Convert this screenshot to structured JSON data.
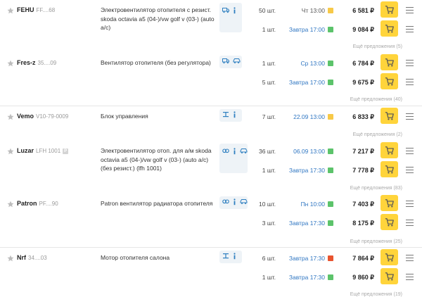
{
  "groups": [
    {
      "brand": "FEHU",
      "article": "FF....68",
      "badge": "",
      "desc": "Электровентилятор отопителя с резист. skoda octavia a5 (04-)/vw golf v (03-) (auto a/c)",
      "icons": [
        "truck-icon",
        "info-icon"
      ],
      "offers": [
        {
          "qty": "50 шт.",
          "date": "Чт 13:00",
          "stock_color": "#f7c948",
          "price": "6 581 ₽",
          "date_style": "grey"
        },
        {
          "qty": "1 шт.",
          "date": "Завтра 17:00",
          "stock_color": "#5cc36b",
          "price": "9 084 ₽",
          "date_style": "blue"
        }
      ],
      "more": "Ещё предложения (5)"
    },
    {
      "brand": "Fres-z",
      "article": "35....09",
      "badge": "",
      "desc": "Вентилятор отопителя (без регулятора)",
      "icons": [
        "truck-icon",
        "car-icon"
      ],
      "offers": [
        {
          "qty": "1 шт.",
          "date": "Ср 13:00",
          "stock_color": "#5cc36b",
          "price": "6 784 ₽",
          "date_style": "blue"
        },
        {
          "qty": "5 шт.",
          "date": "Завтра 17:00",
          "stock_color": "#5cc36b",
          "price": "9 675 ₽",
          "date_style": "blue"
        }
      ],
      "more": "Ещё предложения (40)"
    },
    {
      "brand": "Vemo",
      "article": "V10-79-0009",
      "badge": "",
      "desc": "Блок управления",
      "icons": [
        "scale-icon",
        "info-icon"
      ],
      "offers": [
        {
          "qty": "7 шт.",
          "date": "22.09 13:00",
          "stock_color": "#f7c948",
          "price": "6 833 ₽",
          "date_style": "blue"
        }
      ],
      "more": "Ещё предложения (2)"
    },
    {
      "brand": "Luzar",
      "article": "LFH 1001",
      "badge": "",
      "desc": "Электровентилятор отоп. для а/м skoda octavia a5 (04-)/vw golf v (03-) (auto a/c) (без резист.) (lfh 1001)",
      "icons": [
        "link-icon",
        "info-icon",
        "car-icon"
      ],
      "offers": [
        {
          "qty": "36 шт.",
          "date": "06.09 13:00",
          "stock_color": "#5cc36b",
          "price": "7 217 ₽",
          "date_style": "blue"
        },
        {
          "qty": "1 шт.",
          "date": "Завтра 17:30",
          "stock_color": "#5cc36b",
          "price": "7 778 ₽",
          "date_style": "blue"
        }
      ],
      "more": "Ещё предложения (83)"
    },
    {
      "brand": "Patron",
      "article": "PF....90",
      "badge": "",
      "desc": "Patron вентилятор радиатора отопителя",
      "icons": [
        "link-icon",
        "info-icon",
        "car-icon"
      ],
      "offers": [
        {
          "qty": "10 шт.",
          "date": "Пн 10:00",
          "stock_color": "#5cc36b",
          "price": "7 403 ₽",
          "date_style": "blue"
        },
        {
          "qty": "3 шт.",
          "date": "Завтра 17:30",
          "stock_color": "#5cc36b",
          "price": "8 175 ₽",
          "date_style": "blue"
        }
      ],
      "more": "Ещё предложения (25)"
    },
    {
      "brand": "Nrf",
      "article": "34....03",
      "badge": "",
      "desc": "Мотор отопителя салона",
      "icons": [
        "scale-icon",
        "info-icon"
      ],
      "offers": [
        {
          "qty": "6 шт.",
          "date": "Завтра 17:30",
          "stock_color": "#e8542f",
          "price": "7 864 ₽",
          "date_style": "blue"
        },
        {
          "qty": "1 шт.",
          "date": "Завтра 17:30",
          "stock_color": "#5cc36b",
          "price": "9 860 ₽",
          "date_style": "blue"
        }
      ],
      "more": "Ещё предложения (19)"
    }
  ],
  "colors": {
    "accent_yellow": "#ffd43b",
    "link_blue": "#2f76c2",
    "stock_green": "#5cc36b",
    "stock_yellow": "#f7c948",
    "stock_red": "#e8542f"
  }
}
